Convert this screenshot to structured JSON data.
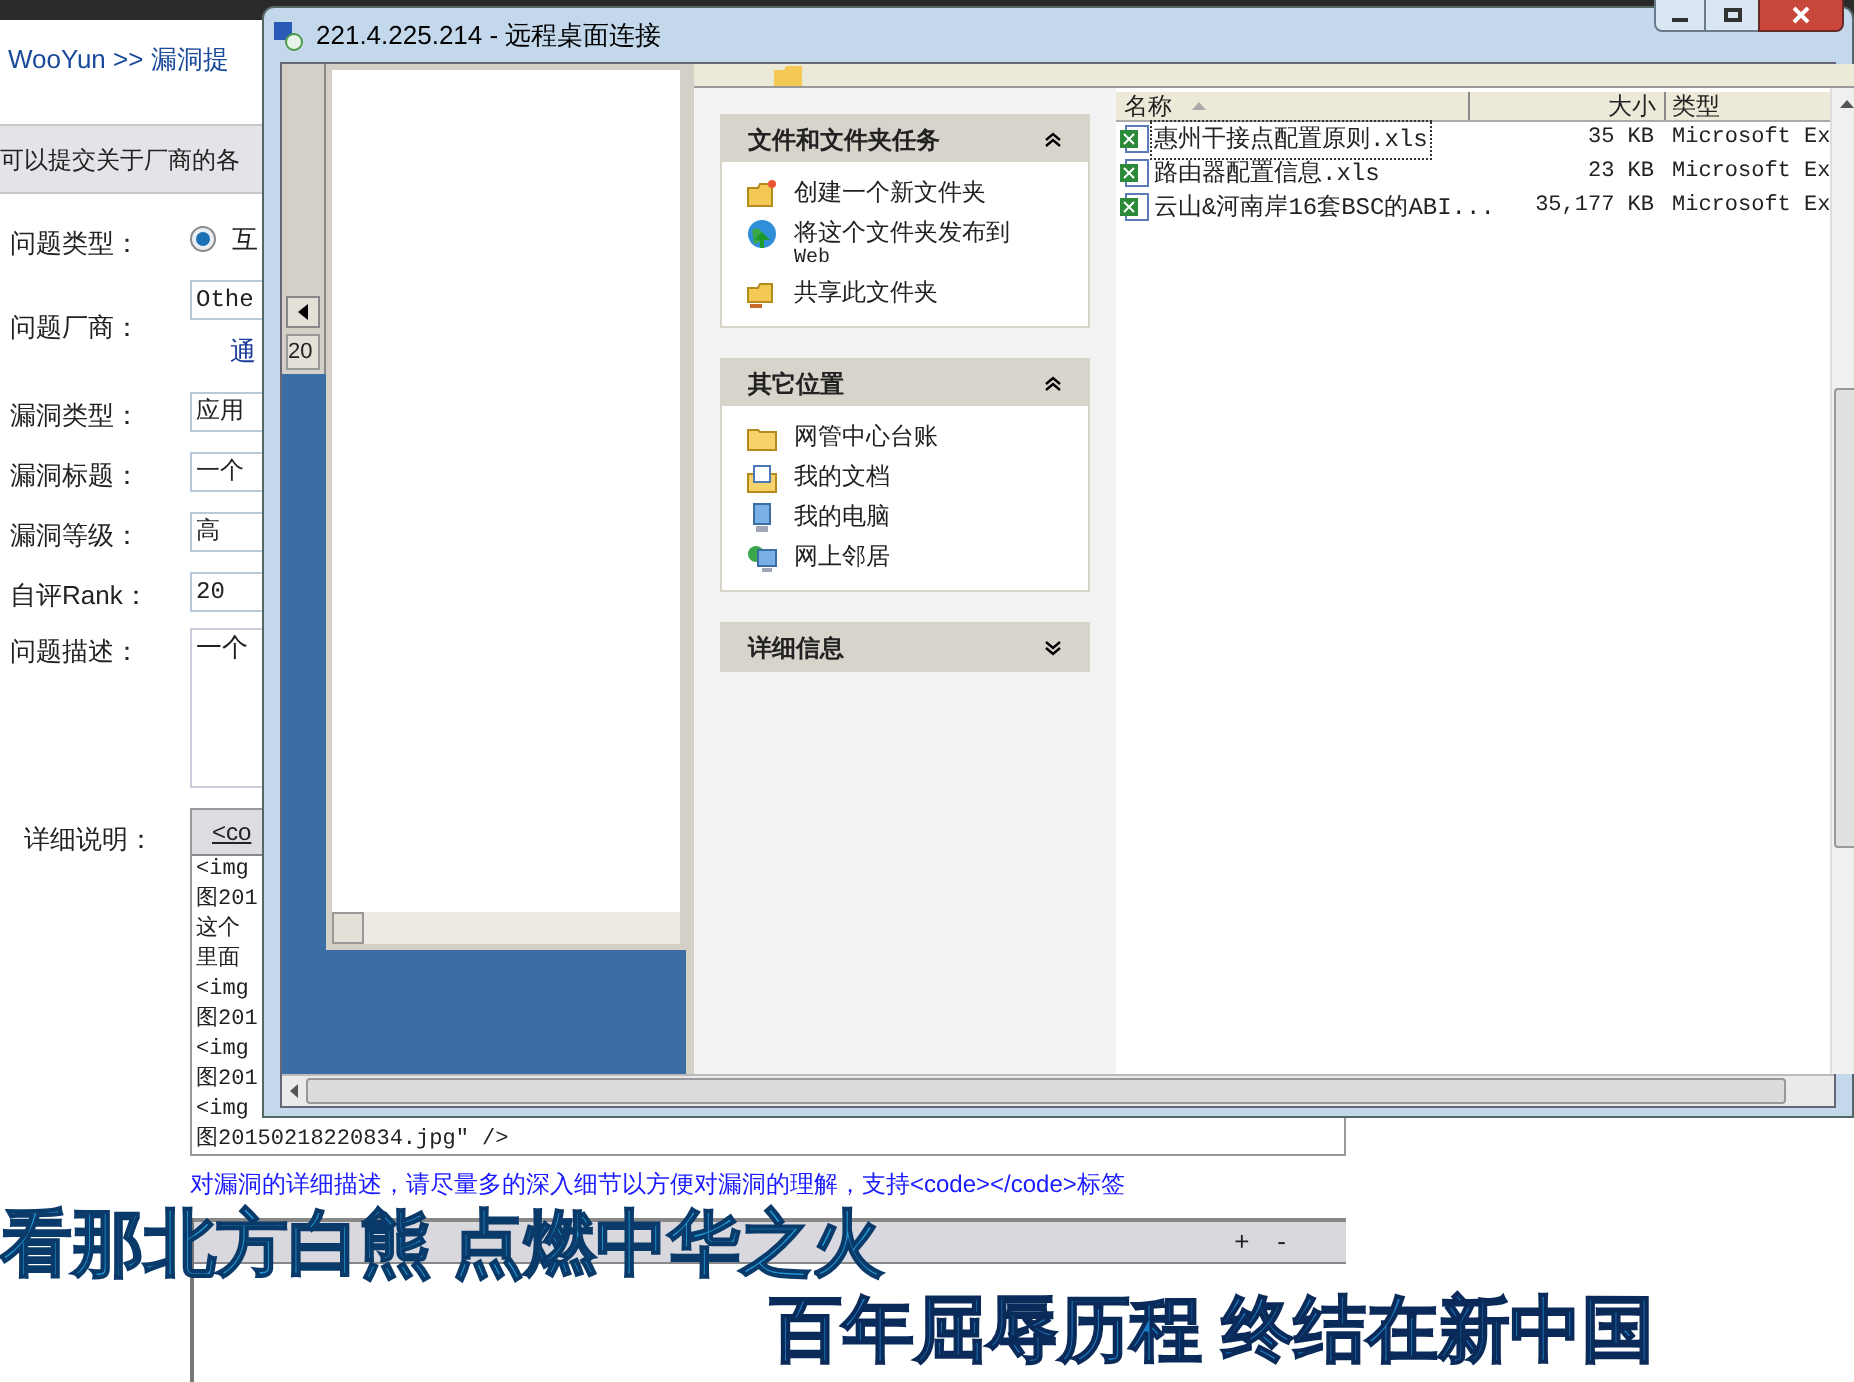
{
  "breadcrumb": {
    "site": "WooYun >>",
    "page": "漏洞提"
  },
  "banner": "可以提交关于厂商的各",
  "form": {
    "fields": [
      {
        "label": "问题类型：",
        "kind": "radio",
        "value": "互",
        "selected": true
      },
      {
        "label": "问题厂商：",
        "kind": "input",
        "value": "Othe",
        "link": "通"
      },
      {
        "label": "漏洞类型：",
        "kind": "select",
        "value": "应用"
      },
      {
        "label": "漏洞标题：",
        "kind": "input",
        "value": "一个"
      },
      {
        "label": "漏洞等级：",
        "kind": "select",
        "value": "高"
      },
      {
        "label": "自评Rank：",
        "kind": "input",
        "value": "20"
      },
      {
        "label": "问题描述：",
        "kind": "textarea",
        "value": "一个"
      }
    ],
    "detail": {
      "label": "详细说明：",
      "toolbar": [
        "<co"
      ],
      "lines": [
        "<img",
        "图201",
        "这个",
        "里面",
        "<img",
        "图201",
        "<img",
        "图201",
        "<img",
        "图20150218220834.jpg\" />"
      ]
    },
    "hint": "对漏洞的详细描述，请尽量多的深入细节以方便对漏洞的理解，支持<code></code>标签",
    "proof_toolbar": {
      "zoom": [
        "+",
        "-"
      ]
    }
  },
  "remote_window": {
    "title": "221.4.225.214 - 远程桌面连接",
    "side_window": {
      "status": "20"
    },
    "explorer": {
      "task_pane": [
        {
          "title": "文件和文件夹任务",
          "expanded": true,
          "items": [
            {
              "kind": "new-folder",
              "label": "创建一个新文件夹"
            },
            {
              "kind": "globe",
              "label": "将这个文件夹发布到",
              "sub": "Web"
            },
            {
              "kind": "share",
              "label": "共享此文件夹"
            }
          ]
        },
        {
          "title": "其它位置",
          "expanded": true,
          "items": [
            {
              "kind": "folder",
              "label": "网管中心台账"
            },
            {
              "kind": "documents",
              "label": "我的文档"
            },
            {
              "kind": "computer",
              "label": "我的电脑"
            },
            {
              "kind": "network",
              "label": "网上邻居"
            }
          ]
        },
        {
          "title": "详细信息",
          "expanded": false
        }
      ],
      "columns": [
        "名称",
        "大小",
        "类型"
      ],
      "files": [
        {
          "name": "惠州干接点配置原则.xls",
          "size": "35 KB",
          "type": "Microsoft Ex",
          "selected": true
        },
        {
          "name": "路由器配置信息.xls",
          "size": "23 KB",
          "type": "Microsoft Ex",
          "selected": false
        },
        {
          "name": "云山&河南岸16套BSC的ABI...",
          "size": "35,177 KB",
          "type": "Microsoft Ex",
          "selected": false
        }
      ]
    }
  },
  "overlay": {
    "line_1": "看那北方白熊 点燃中华之火",
    "line_2": "百年屈辱历程 终结在新中国"
  }
}
